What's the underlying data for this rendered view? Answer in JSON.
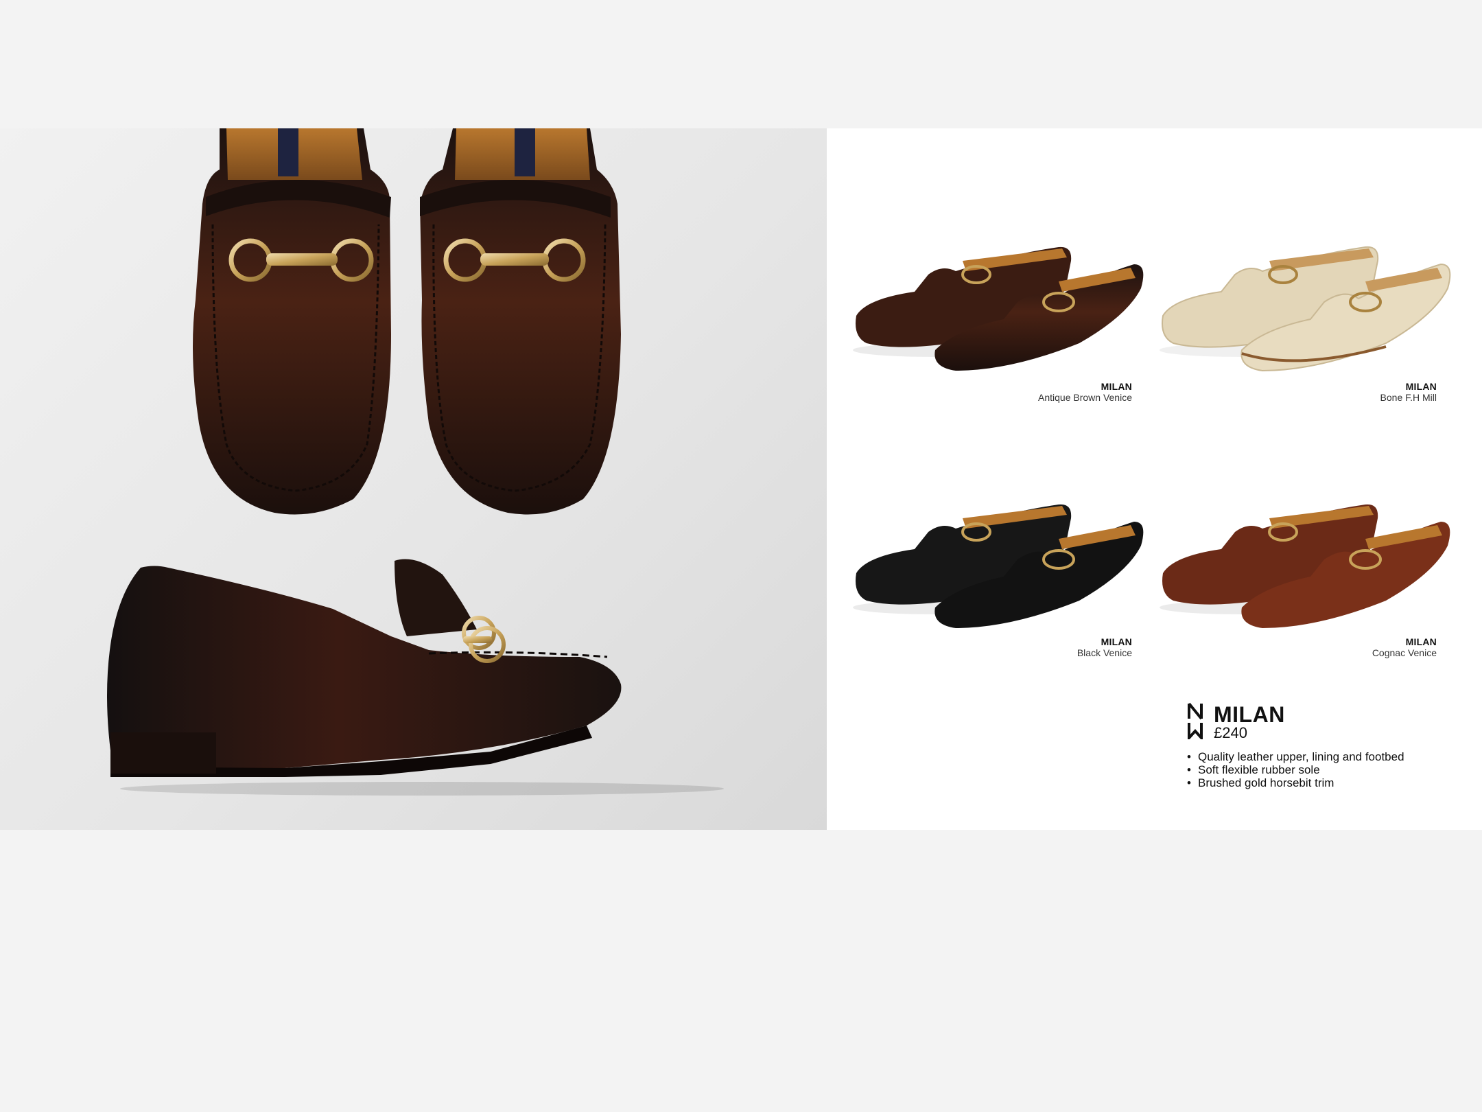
{
  "hero": {
    "top_view_alt": "Milan loafer pair, top view",
    "side_view_alt": "Milan loafer, side view"
  },
  "colorways": [
    {
      "model": "MILAN",
      "color": "Antique Brown Venice",
      "swatch": "#4a2417"
    },
    {
      "model": "MILAN",
      "color": "Bone F.H Mill",
      "swatch": "#e3d6b8"
    },
    {
      "model": "MILAN",
      "color": "Black Venice",
      "swatch": "#161616"
    },
    {
      "model": "MILAN",
      "color": "Cognac Venice",
      "swatch": "#6b2a17"
    }
  ],
  "product": {
    "name": "MILAN",
    "price": "£240",
    "features": [
      "Quality leather upper, lining and footbed",
      "Soft flexible rubber sole",
      "Brushed gold horsebit trim"
    ]
  },
  "colors": {
    "hardware_gold": "#c8a35a",
    "leather_dark_brown": "#3b1a10",
    "page_background": "#f3f3f3"
  }
}
